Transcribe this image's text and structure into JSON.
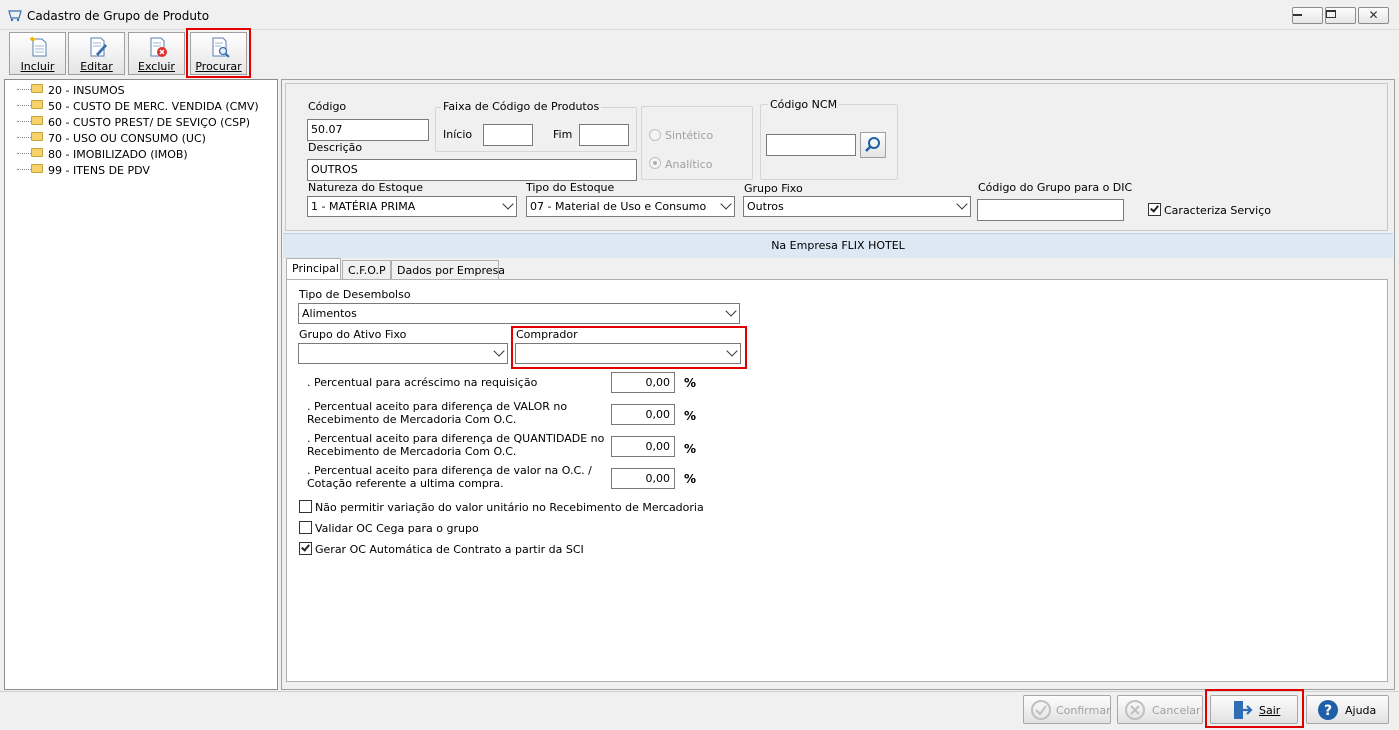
{
  "window": {
    "title": "Cadastro de Grupo de Produto",
    "minimize_icon": "minimize-icon",
    "maximize_icon": "restore-icon",
    "close_icon": "close-icon"
  },
  "toolbar": {
    "incluir": "Incluir",
    "editar": "Editar",
    "excluir": "Excluir",
    "procurar": "Procurar"
  },
  "tree": {
    "items": [
      {
        "label": "20 - INSUMOS"
      },
      {
        "label": "50 - CUSTO DE MERC. VENDIDA (CMV)"
      },
      {
        "label": "60 - CUSTO PREST/ DE SEVIÇO (CSP)"
      },
      {
        "label": "70 - USO OU CONSUMO (UC)"
      },
      {
        "label": "80 - IMOBILIZADO (IMOB)"
      },
      {
        "label": "99 - ITENS DE PDV"
      }
    ]
  },
  "form": {
    "codigo_label": "Código",
    "codigo_value": "50.07",
    "faixa_title": "Faixa de Código de Produtos",
    "inicio_label": "Início",
    "fim_label": "Fim",
    "sintetico_label": "Sintético",
    "analitico_label": "Analítico",
    "ncm_title": "Código NCM",
    "descricao_label": "Descrição",
    "descricao_value": "OUTROS",
    "natureza_label": "Natureza do Estoque",
    "natureza_value": "1 - MATÉRIA PRIMA",
    "tipo_label": "Tipo do Estoque",
    "tipo_value": "07 - Material de Uso e Consumo",
    "grupo_fixo_label": "Grupo Fixo",
    "grupo_fixo_value": "Outros",
    "dic_label": "Código do Grupo para o DIC",
    "caracteriza_label": "Caracteriza Serviço"
  },
  "banner": "Na Empresa FLIX HOTEL",
  "tabs": [
    {
      "label": "Principal"
    },
    {
      "label": "C.F.O.P"
    },
    {
      "label": "Dados por Empresa"
    }
  ],
  "principal": {
    "desembolso_label": "Tipo de Desembolso",
    "desembolso_value": "Alimentos",
    "ativo_label": "Grupo do Ativo Fixo",
    "comprador_label": "Comprador",
    "pct1_label": ". Percentual para acréscimo na requisição",
    "pct1_value": "0,00",
    "pct2_line1": ". Percentual aceito para diferença de VALOR no",
    "pct2_line2": "Recebimento de Mercadoria Com O.C.",
    "pct2_value": "0,00",
    "pct3_line1": ". Percentual aceito para diferença de QUANTIDADE no",
    "pct3_line2": "Recebimento de Mercadoria Com O.C.",
    "pct3_value": "0,00",
    "pct4_line1": ". Percentual aceito para diferença de valor na O.C. /",
    "pct4_line2": "Cotação referente a ultima compra.",
    "pct4_value": "0,00",
    "pct_sign": "%",
    "chk1_label": "Não permitir variação do valor unitário no Recebimento de Mercadoria",
    "chk2_label": "Validar OC Cega para o grupo",
    "chk3_label": "Gerar OC Automática de Contrato a partir da SCI"
  },
  "bottom": {
    "confirmar": "Confirmar",
    "cancelar": "Cancelar",
    "sair": "Sair",
    "ajuda": "Ajuda"
  },
  "colors": {
    "highlight": "#e10000",
    "banner": "#dce8f4",
    "help_blue": "#1f5fa8"
  }
}
